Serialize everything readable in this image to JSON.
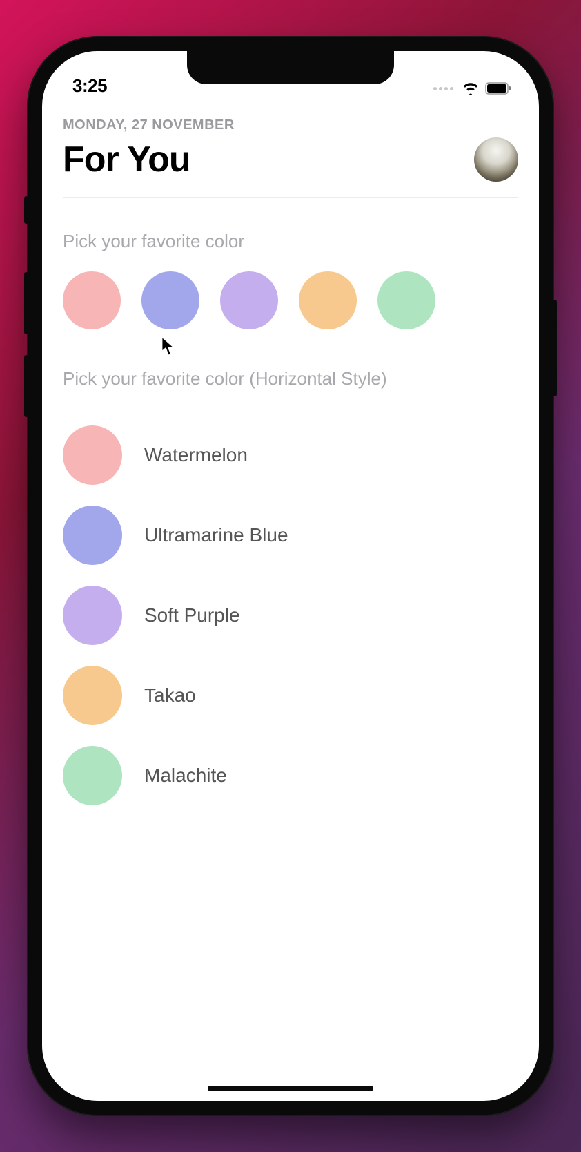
{
  "status": {
    "time": "3:25"
  },
  "header": {
    "date": "MONDAY, 27 NOVEMBER",
    "title": "For You"
  },
  "section1": {
    "label": "Pick your favorite color"
  },
  "section2": {
    "label": "Pick your favorite color (Horizontal Style)"
  },
  "colors": [
    {
      "name": "Watermelon",
      "hex": "#f7b5b5"
    },
    {
      "name": "Ultramarine Blue",
      "hex": "#a1a7ea"
    },
    {
      "name": "Soft Purple",
      "hex": "#c4aeee"
    },
    {
      "name": "Takao",
      "hex": "#f8c98e"
    },
    {
      "name": "Malachite",
      "hex": "#afe4c0"
    }
  ]
}
